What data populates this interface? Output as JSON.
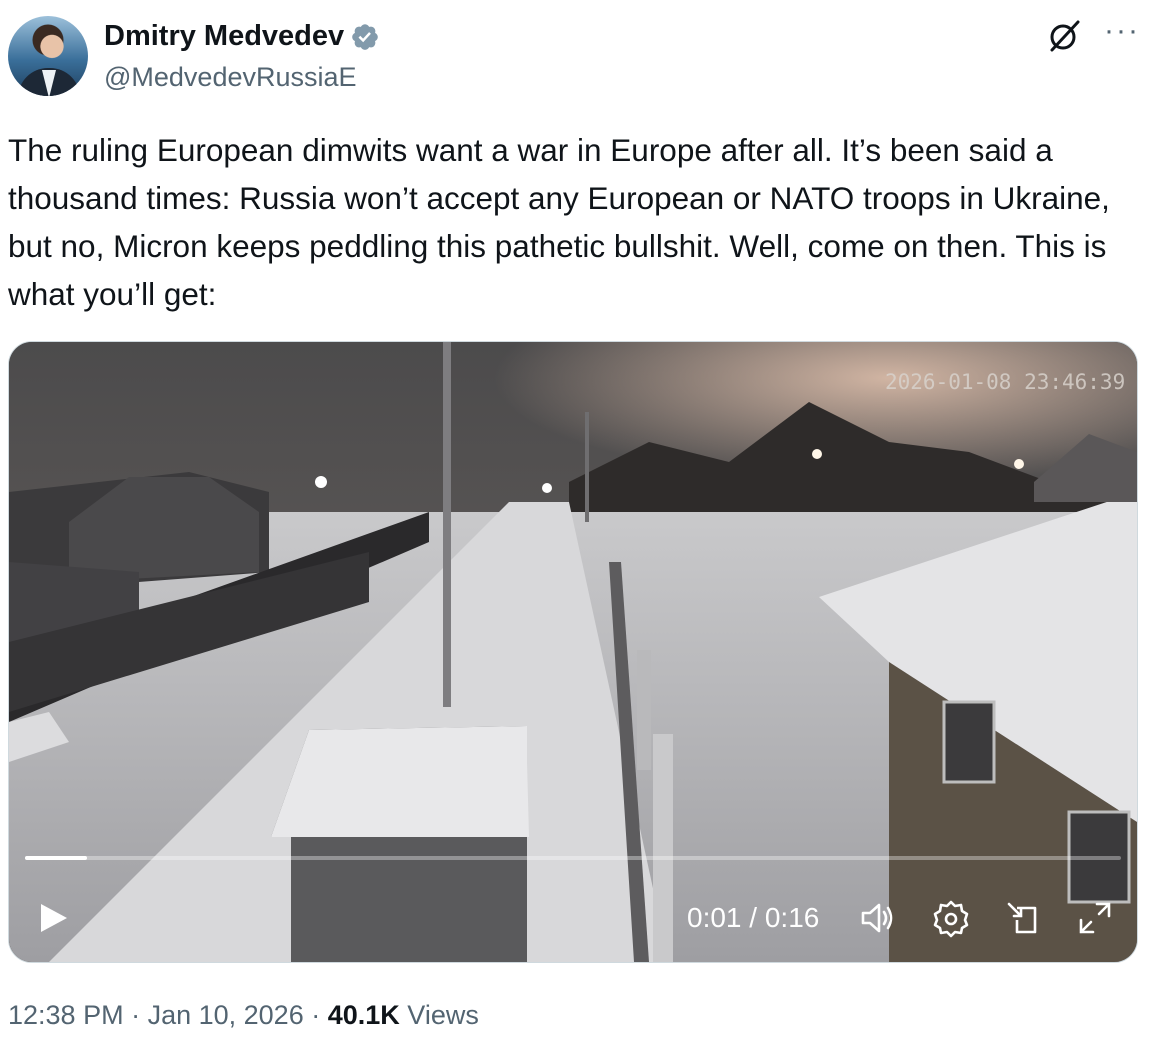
{
  "author": {
    "name": "Dmitry Medvedev",
    "handle": "@MedvedevRussiaE",
    "verified": true
  },
  "tweet": {
    "text": "The ruling European dimwits want a war in Europe after all. It’s been said a thousand times: Russia won’t accept any European or NATO troops in Ukraine, but no, Micron keeps peddling this pathetic bullshit. Well, come on then. This is what you’ll get:"
  },
  "video": {
    "timestamp_overlay": "2026-01-08 23:46:39",
    "current_time": "0:01",
    "separator": " / ",
    "duration": "0:16",
    "progress_fraction": 0.057,
    "controls": [
      "play-icon",
      "volume-icon",
      "settings-icon",
      "picture-in-picture-icon",
      "fullscreen-icon"
    ]
  },
  "meta": {
    "time": "12:38 PM",
    "dot": " · ",
    "date": "Jan 10, 2026",
    "views_count": "40.1K",
    "views_label": "Views"
  },
  "colors": {
    "verified_badge": "#829aab",
    "secondary_text": "#536471",
    "primary_text": "#0f1419"
  }
}
